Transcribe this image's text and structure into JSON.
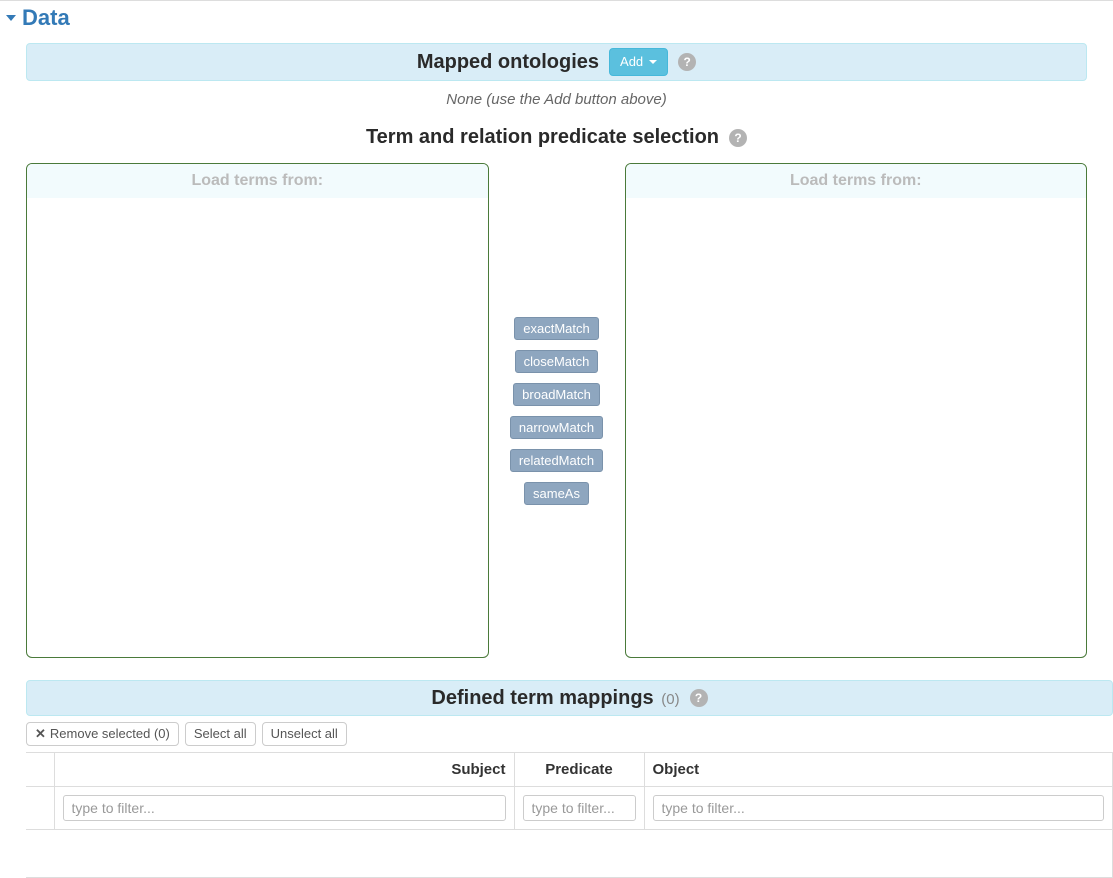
{
  "section": {
    "title": "Data"
  },
  "mapped": {
    "title": "Mapped ontologies",
    "add_label": "Add",
    "none_text": "None (use the Add button above)"
  },
  "termsel": {
    "title": "Term and relation predicate selection",
    "left_header": "Load terms from:",
    "right_header": "Load terms from:",
    "predicates": [
      "exactMatch",
      "closeMatch",
      "broadMatch",
      "narrowMatch",
      "relatedMatch",
      "sameAs"
    ]
  },
  "defined": {
    "title": "Defined term mappings",
    "count_display": "(0)",
    "remove_label": "Remove selected (0)",
    "select_all_label": "Select all",
    "unselect_all_label": "Unselect all",
    "columns": {
      "subject": "Subject",
      "predicate": "Predicate",
      "object": "Object"
    },
    "filter_placeholder": "type to filter..."
  }
}
